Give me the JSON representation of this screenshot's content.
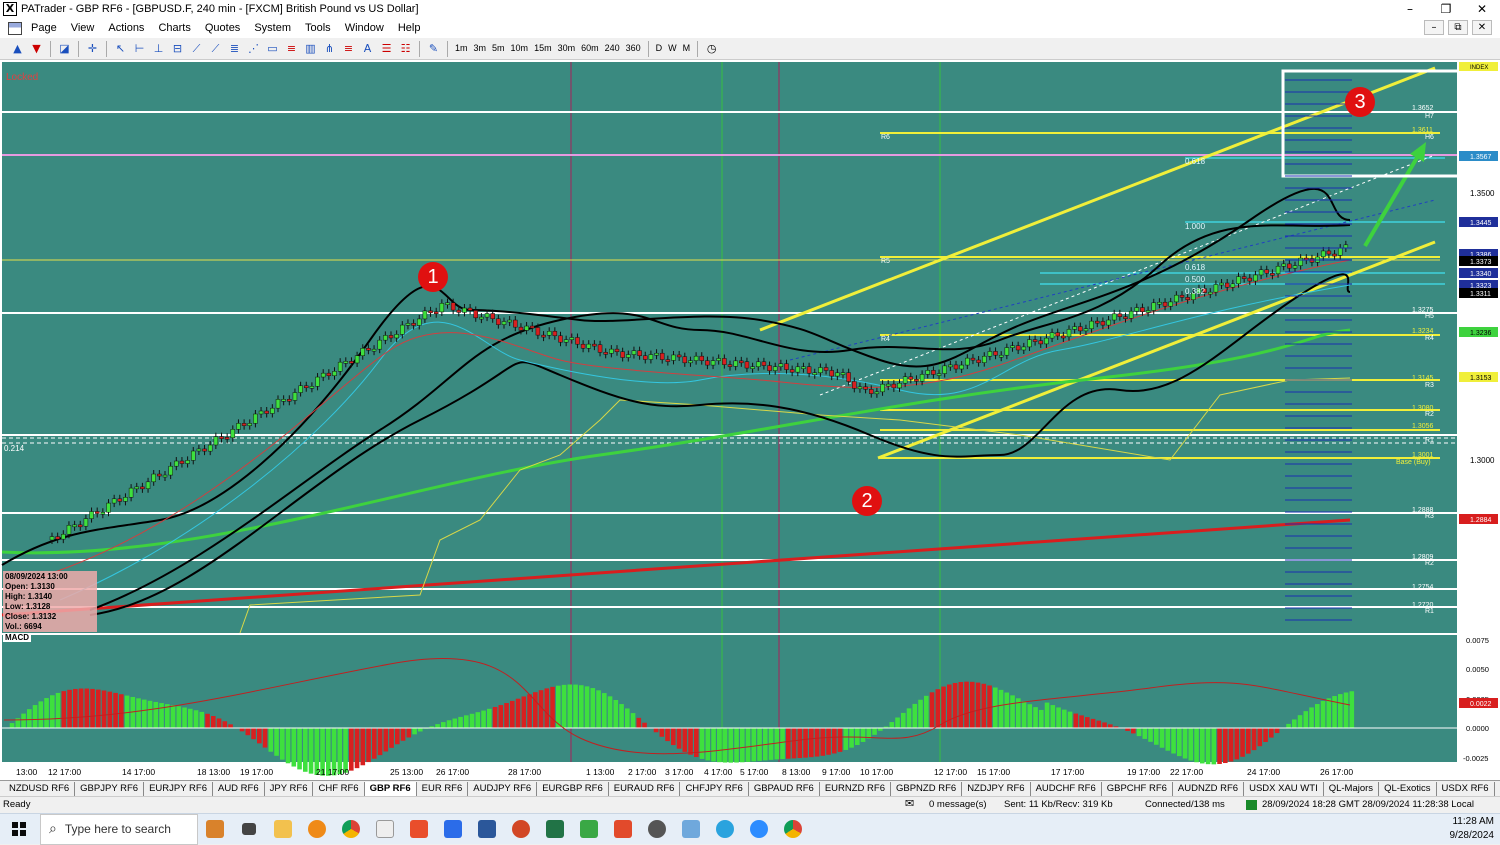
{
  "window": {
    "app_icon": "X",
    "title": "PATrader - GBP RF6 - [GBPUSD.F, 240 min - [FXCM] British Pound vs US Dollar]",
    "controls": [
      "–",
      "❐",
      "✕"
    ]
  },
  "menu": {
    "items": [
      "Page",
      "View",
      "Actions",
      "Charts",
      "Quotes",
      "System",
      "Tools",
      "Window",
      "Help"
    ],
    "mdi_controls": [
      "–",
      "⧉",
      "✕"
    ]
  },
  "toolbar": {
    "timeframes": [
      "1m",
      "3m",
      "5m",
      "10m",
      "15m",
      "30m",
      "60m",
      "240",
      "360"
    ],
    "periods": [
      "D",
      "W",
      "M"
    ]
  },
  "chart": {
    "locked_label": "Locked",
    "left_marker": "0.214",
    "macd_label": "MACD",
    "ohlc": {
      "date": "08/09/2024 13:00",
      "open": "Open: 1.3130",
      "high": "High: 1.3140",
      "low": "Low: 1.3128",
      "close": "Close: 1.3132",
      "vol": "Vol.: 6694"
    },
    "badges": [
      "1",
      "2",
      "3"
    ],
    "corner_label": "INDEX",
    "price_axis": [
      "1.3500",
      "1.3000"
    ],
    "price_tags": [
      "1.3567",
      "1.3445",
      "1.3386",
      "1.3373",
      "1.3340",
      "1.3323",
      "1.3311",
      "1.3236",
      "1.3153",
      "1.2884"
    ],
    "level_labels": {
      "r6": "1.3652",
      "r6b": "1.3611",
      "r5": "1.3275",
      "r4": "1.3234",
      "r3": "1.3145",
      "r2": "1.3080",
      "r1": "1.3056",
      "base": "1.3001",
      "base_txt": "Base (Buy)",
      "s4": "1.2888",
      "s3": "1.2809",
      "s2": "1.2754",
      "s1": "1.2720"
    },
    "pivot_tags": [
      "H7",
      "H6",
      "R6",
      "H5",
      "R4",
      "R3",
      "R2",
      "R1",
      "R5",
      "R4",
      "R3",
      "R2",
      "R1"
    ],
    "fib_labels": [
      "1.000",
      "0.618",
      "0.500",
      "0.382",
      "0.618"
    ],
    "macd_axis": [
      "0.0075",
      "0.0050",
      "0.0025",
      "0.0000",
      "-0.0025"
    ],
    "macd_tag": "0.0022",
    "date_axis": [
      "13:00",
      "12 17:00",
      "14 17:00",
      "18 13:00",
      "19 17:00",
      "21 17:00",
      "25 13:00",
      "26 17:00",
      "28 17:00",
      "1 13:00",
      "2 17:00",
      "3 17:00",
      "4 17:00",
      "5 17:00",
      "8 13:00",
      "9 17:00",
      "10 17:00",
      "12 17:00",
      "15 17:00",
      "17 17:00",
      "19 17:00",
      "22 17:00",
      "24 17:00",
      "26 17:00"
    ]
  },
  "tabs": [
    "NZDUSD RF6",
    "GBPJPY RF6",
    "EURJPY RF6",
    "AUD RF6",
    "JPY RF6",
    "CHF RF6",
    "GBP RF6",
    "EUR RF6",
    "AUDJPY RF6",
    "EURGBP RF6",
    "EURAUD RF6",
    "CHFJPY RF6",
    "GBPAUD RF6",
    "EURNZD RF6",
    "GBPNZD RF6",
    "NZDJPY RF6",
    "AUDCHF RF6",
    "GBPCHF RF6",
    "AUDNZD RF6",
    "USDX XAU WTI",
    "QL-Majors",
    "QL-Exotics",
    "USDX RF6",
    "Bitcoin"
  ],
  "active_tab": "GBP RF6",
  "status": {
    "ready": "Ready",
    "messages": "0 message(s)",
    "traffic": "Sent: 11 Kb/Recv: 319 Kb",
    "connected": "Connected/138 ms",
    "times": "28/09/2024 18:28 GMT  28/09/2024 11:28:38 Local"
  },
  "taskbar": {
    "search_placeholder": "Type here to search",
    "time": "11:28 AM",
    "date": "9/28/2024"
  }
}
